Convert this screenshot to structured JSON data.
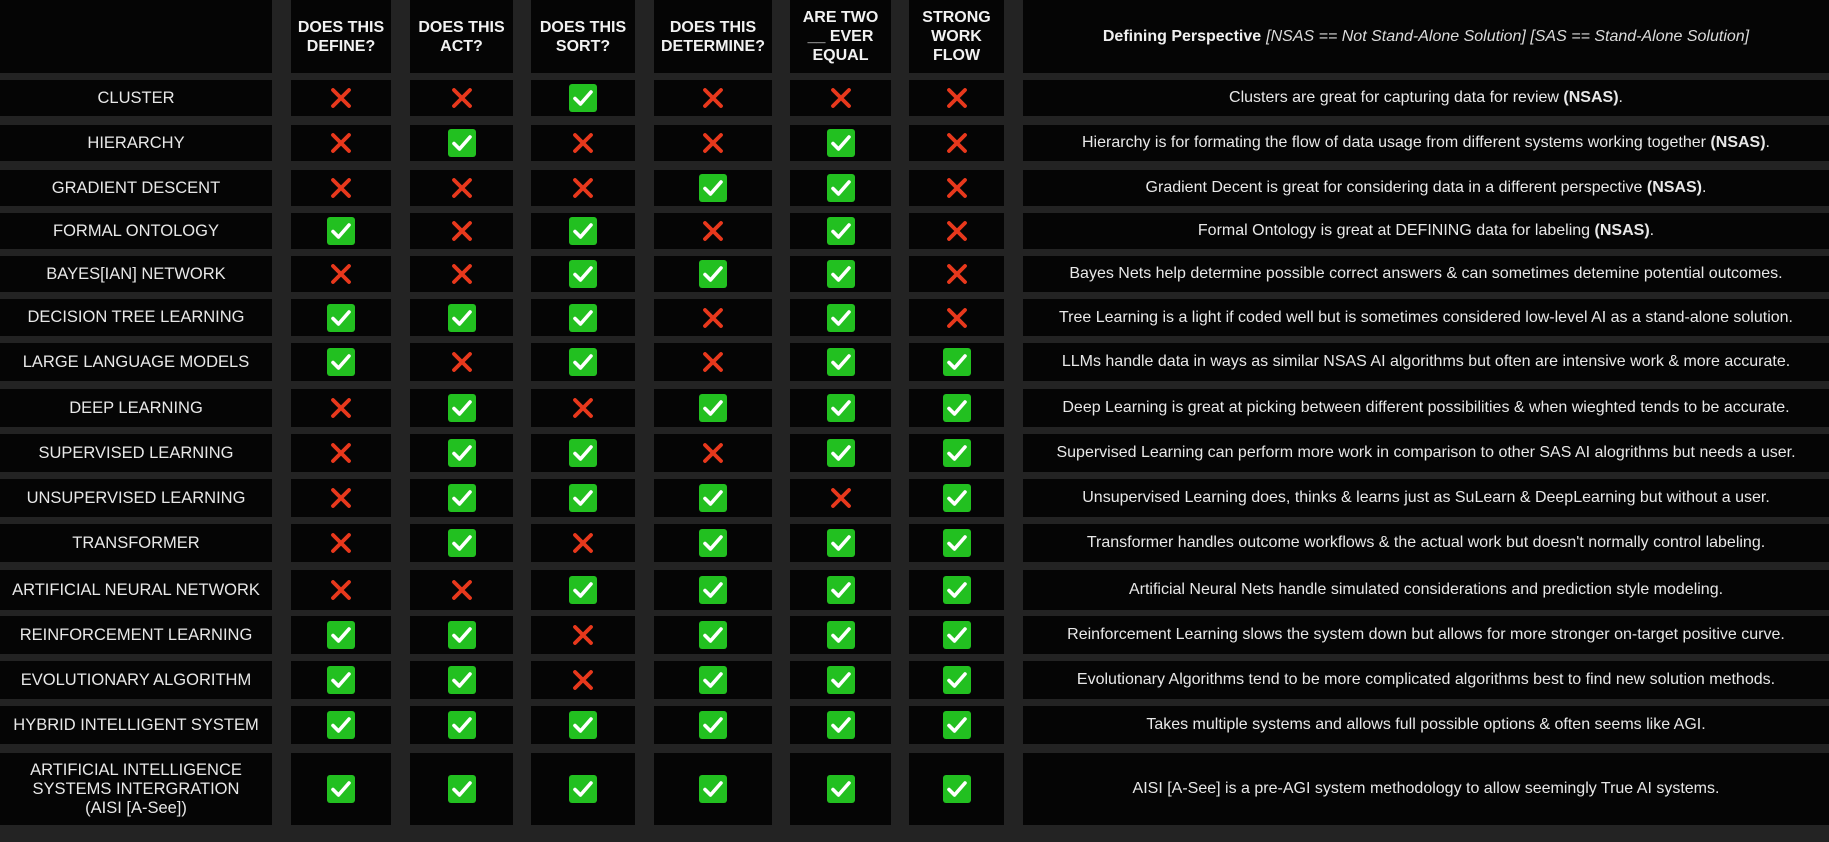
{
  "headers": {
    "name": "",
    "define": "DOES THIS DEFINE?",
    "act": "DOES THIS ACT?",
    "sort": "DOES THIS SORT?",
    "determine": "DOES THIS DETERMINE?",
    "equal": "ARE TWO __ EVER EQUAL",
    "workflow": "STRONG WORK FLOW",
    "desc_bold": "Defining Perspective",
    "desc_italic": "[NSAS == Not Stand-Alone Solution] [SAS == Stand-Alone Solution]"
  },
  "legend": {
    "yes": "check-icon",
    "no": "cross-icon",
    "yes_color": "#22c020",
    "no_color": "#e8381c"
  },
  "rows": [
    {
      "name": "CLUSTER",
      "marks": [
        false,
        false,
        true,
        false,
        false,
        false
      ],
      "desc": "Clusters are great for capturing data for review",
      "desc_bold": "(NSAS)",
      "desc_end": "."
    },
    {
      "name": "HIERARCHY",
      "marks": [
        false,
        true,
        false,
        false,
        true,
        false
      ],
      "desc": "Hierarchy is for formating the flow of data usage from different systems working together",
      "desc_bold": "(NSAS)",
      "desc_end": "."
    },
    {
      "name": "GRADIENT DESCENT",
      "marks": [
        false,
        false,
        false,
        true,
        true,
        false
      ],
      "desc": "Gradient Decent is great for considering data in a different perspective",
      "desc_bold": "(NSAS)",
      "desc_end": "."
    },
    {
      "name": "FORMAL ONTOLOGY",
      "marks": [
        true,
        false,
        true,
        false,
        true,
        false
      ],
      "desc": "Formal Ontology is great at DEFINING data for labeling",
      "desc_bold": "(NSAS)",
      "desc_end": "."
    },
    {
      "name": "BAYES[IAN] NETWORK",
      "marks": [
        false,
        false,
        true,
        true,
        true,
        false
      ],
      "desc": "Bayes Nets help determine possible correct answers & can sometimes detemine potential outcomes.",
      "desc_bold": "",
      "desc_end": ""
    },
    {
      "name": "DECISION TREE LEARNING",
      "marks": [
        true,
        true,
        true,
        false,
        true,
        false
      ],
      "desc": "Tree Learning is a light if coded well but is sometimes considered low-level AI as a stand-alone solution.",
      "desc_bold": "",
      "desc_end": ""
    },
    {
      "name": "LARGE LANGUAGE MODELS",
      "marks": [
        true,
        false,
        true,
        false,
        true,
        true
      ],
      "desc": "LLMs handle data in ways as similar NSAS AI algorithms but often are intensive work & more accurate.",
      "desc_bold": "",
      "desc_end": ""
    },
    {
      "name": "DEEP LEARNING",
      "marks": [
        false,
        true,
        false,
        true,
        true,
        true
      ],
      "desc": "Deep Learning is great at picking between different possibilities & when wieghted tends to be accurate.",
      "desc_bold": "",
      "desc_end": ""
    },
    {
      "name": "SUPERVISED LEARNING",
      "marks": [
        false,
        true,
        true,
        false,
        true,
        true
      ],
      "desc": "Supervised Learning can perform more work in comparison to other SAS AI alogrithms but needs a user.",
      "desc_bold": "",
      "desc_end": ""
    },
    {
      "name": "UNSUPERVISED LEARNING",
      "marks": [
        false,
        true,
        true,
        true,
        false,
        true
      ],
      "desc": "Unsupervised Learning does, thinks & learns just as SuLearn & DeepLearning but without a user.",
      "desc_bold": "",
      "desc_end": ""
    },
    {
      "name": "TRANSFORMER",
      "marks": [
        false,
        true,
        false,
        true,
        true,
        true
      ],
      "desc": "Transformer handles outcome workflows & the actual work but doesn't normally control labeling.",
      "desc_bold": "",
      "desc_end": ""
    },
    {
      "name": "ARTIFICIAL NEURAL NETWORK",
      "marks": [
        false,
        false,
        true,
        true,
        true,
        true
      ],
      "desc": "Artificial Neural Nets handle simulated considerations and prediction style modeling.",
      "desc_bold": "",
      "desc_end": ""
    },
    {
      "name": "REINFORCEMENT LEARNING",
      "marks": [
        true,
        true,
        false,
        true,
        true,
        true
      ],
      "desc": "Reinforcement Learning slows the system down but allows for more stronger on-target positive curve.",
      "desc_bold": "",
      "desc_end": ""
    },
    {
      "name": "EVOLUTIONARY ALGORITHM",
      "marks": [
        true,
        true,
        false,
        true,
        true,
        true
      ],
      "desc": "Evolutionary Algorithms tend to be more complicated algorithms best to find new solution methods.",
      "desc_bold": "",
      "desc_end": ""
    },
    {
      "name": "HYBRID INTELLIGENT SYSTEM",
      "marks": [
        true,
        true,
        true,
        true,
        true,
        true
      ],
      "desc": "Takes multiple systems and allows full possible options & often seems like AGI.",
      "desc_bold": "",
      "desc_end": ""
    },
    {
      "name": "ARTIFICIAL INTELLIGENCE SYSTEMS INTERGRATION (AISI [A-See])",
      "marks": [
        true,
        true,
        true,
        true,
        true,
        true
      ],
      "desc": "AISI [A-See] is a pre-AGI system methodology to allow seemingly True AI systems.",
      "desc_bold": "",
      "desc_end": ""
    }
  ]
}
